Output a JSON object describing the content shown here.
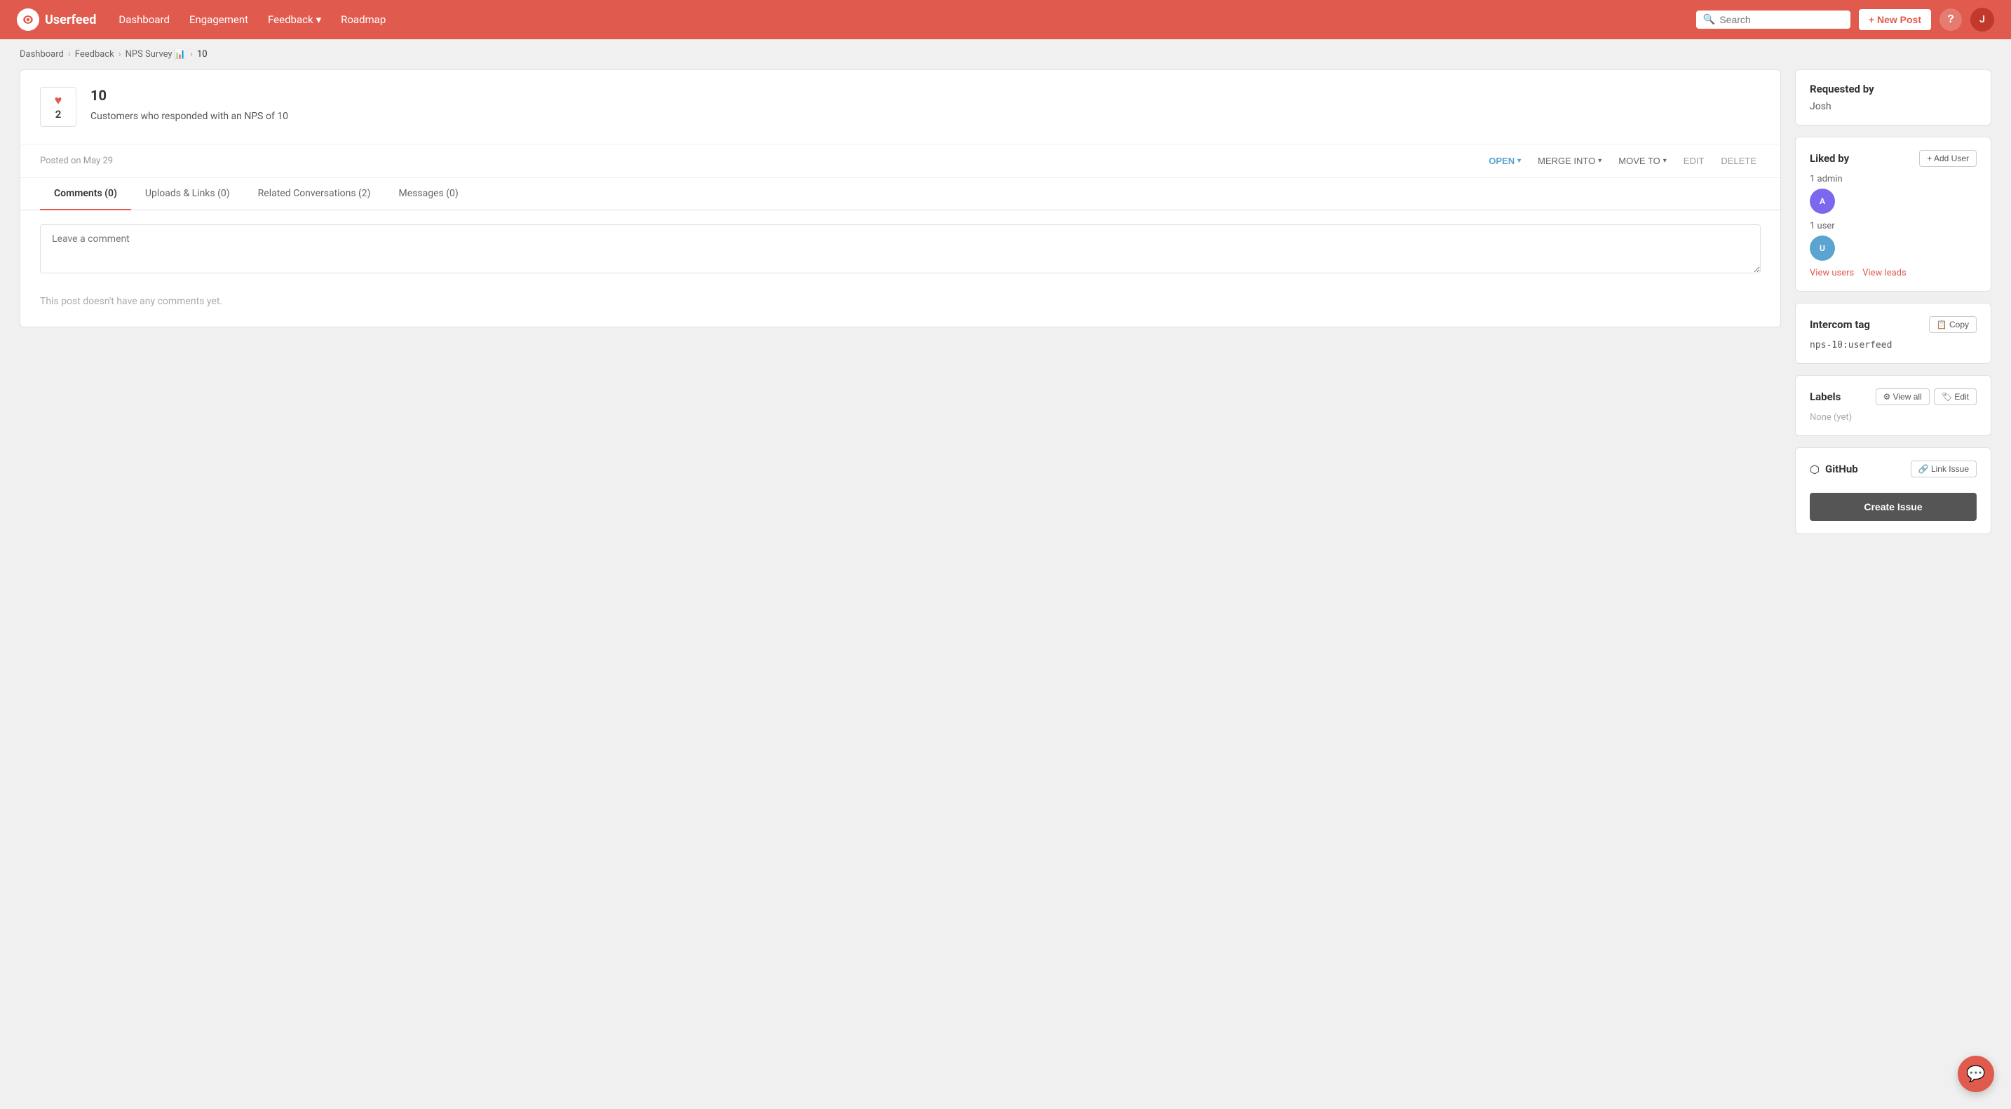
{
  "brand": {
    "name": "Userfeed"
  },
  "nav": {
    "links": [
      {
        "id": "dashboard",
        "label": "Dashboard"
      },
      {
        "id": "engagement",
        "label": "Engagement"
      },
      {
        "id": "feedback",
        "label": "Feedback",
        "hasDropdown": true
      },
      {
        "id": "roadmap",
        "label": "Roadmap"
      }
    ],
    "search_placeholder": "Search",
    "new_post_label": "+ New Post",
    "help_label": "?"
  },
  "breadcrumb": {
    "items": [
      {
        "label": "Dashboard",
        "href": "#"
      },
      {
        "label": "Feedback",
        "href": "#"
      },
      {
        "label": "NPS Survey 📊",
        "href": "#"
      },
      {
        "label": "10"
      }
    ]
  },
  "post": {
    "title": "10",
    "description": "Customers who responded with an NPS of 10",
    "votes": 2,
    "date": "Posted on May 29",
    "status": "OPEN",
    "actions": {
      "open_label": "OPEN",
      "merge_label": "MERGE INTO",
      "move_label": "MOVE TO",
      "edit_label": "EDIT",
      "delete_label": "DELETE"
    }
  },
  "tabs": [
    {
      "id": "comments",
      "label": "Comments (0)",
      "active": true
    },
    {
      "id": "uploads",
      "label": "Uploads & Links (0)",
      "active": false
    },
    {
      "id": "conversations",
      "label": "Related Conversations (2)",
      "active": false
    },
    {
      "id": "messages",
      "label": "Messages (0)",
      "active": false
    }
  ],
  "comment": {
    "placeholder": "Leave a comment",
    "empty_message": "This post doesn't have any comments yet."
  },
  "sidebar": {
    "requested_by": {
      "title": "Requested by",
      "value": "Josh"
    },
    "liked_by": {
      "title": "Liked by",
      "add_user_label": "+ Add User",
      "admin_label": "1 admin",
      "user_label": "1 user",
      "view_users_label": "View users",
      "view_leads_label": "View leads"
    },
    "intercom_tag": {
      "title": "Intercom tag",
      "value": "nps-10:userfeed",
      "copy_label": "📋 Copy"
    },
    "labels": {
      "title": "Labels",
      "view_all_label": "⚙ View all",
      "edit_label": "🏷 Edit",
      "none_label": "None (yet)"
    },
    "github": {
      "title": "GitHub",
      "link_issue_label": "🔗 Link Issue",
      "create_issue_label": "Create Issue"
    }
  }
}
